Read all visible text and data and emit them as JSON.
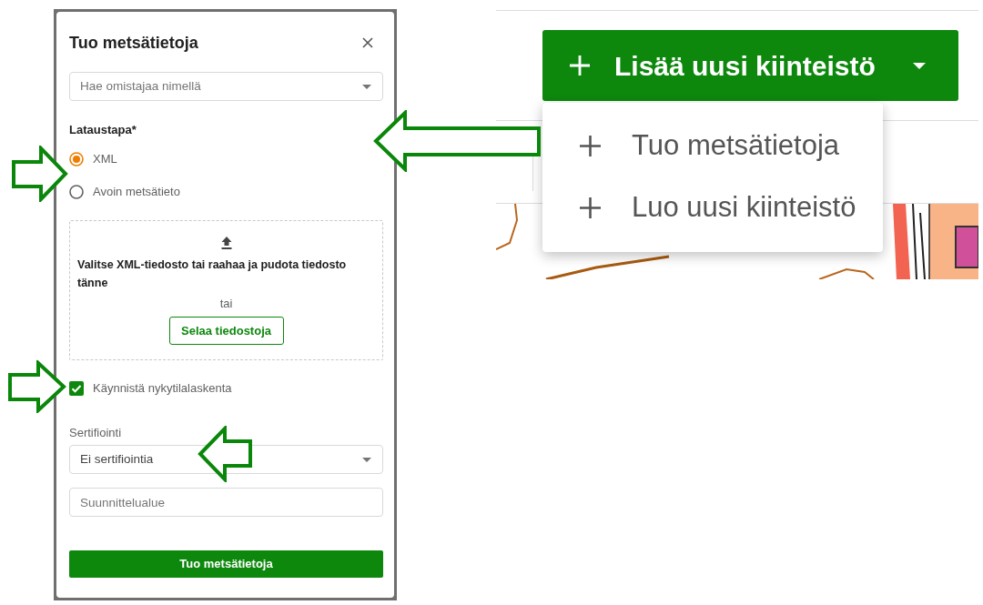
{
  "dialog": {
    "title": "Tuo metsätietoja",
    "owner_search": {
      "placeholder": "Hae omistajaa nimellä"
    },
    "upload_method": {
      "label": "Lataustapa*",
      "options": [
        {
          "label": "XML",
          "selected": true
        },
        {
          "label": "Avoin metsätieto",
          "selected": false
        }
      ]
    },
    "drop_zone": {
      "instructions": "Valitse XML-tiedosto tai raahaa ja pudota tiedosto tänne",
      "separator": "tai",
      "browse_button": "Selaa tiedostoja"
    },
    "start_calculation": {
      "label": "Käynnistä nykytilalaskenta",
      "checked": true
    },
    "certification": {
      "label": "Sertifiointi",
      "value": "Ei sertifiointia"
    },
    "planning_area": {
      "placeholder": "Suunnittelualue"
    },
    "submit_button": "Tuo metsätietoja"
  },
  "add_property_button": {
    "label": "Lisää uusi kiinteistö",
    "expanded": true
  },
  "menu": {
    "items": [
      {
        "label": "Tuo metsätietoja"
      },
      {
        "label": "Luo uusi kiinteistö"
      }
    ]
  }
}
